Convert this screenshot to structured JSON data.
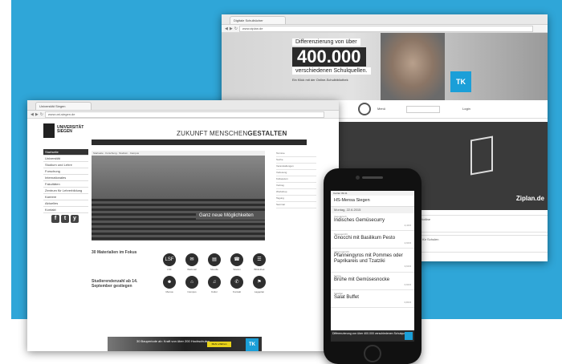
{
  "back_window": {
    "tab_title": "Digitale Schulbücher",
    "url": "www.ziplan.de",
    "banner_line1": "Differenzierung von über",
    "banner_number": "400.000",
    "banner_line3": "verschiedenen Schulquellen.",
    "banner_small": "Ein Klick mit der Online-Schulbibliothek",
    "tk_logo": "TK",
    "menu_label": "Menü",
    "login_label": "Login",
    "question_text": "n?",
    "brand": "Ziplan.de",
    "side_title": "Service-Hotline",
    "side_text": "Montag bis Freitag",
    "side_items": [
      "Service-Hotline",
      "Werbung für Schulen"
    ]
  },
  "front_window": {
    "tab_title": "Universität Siegen",
    "url": "www.uni-siegen.de",
    "logo_text": "UNIVERSITÄT SIEGEN",
    "slogan_light": "ZUKUNFT MENSCHEN",
    "slogan_bold": "GESTALTEN",
    "hero_tabs": "Startseite · Forschung · Studium · Campus",
    "hero_caption": "Ganz neue Möglichkeiten",
    "nav_items": [
      "Startseite",
      "Universität",
      "Studium und Lehre",
      "Forschung",
      "Internationales",
      "Fakultäten",
      "Zentrum für Lehrerbildung",
      "Karriere",
      "Aktuelles",
      "Kontakt"
    ],
    "social": [
      "f",
      "t",
      "y"
    ],
    "right_lines": [
      "Termine",
      "Suche",
      "Veranstaltungen",
      "Vorlesung",
      "Kolloquium",
      "Vortrag",
      "Workshop",
      "Tagung",
      "Seminar"
    ],
    "news_title": "30 Materialien im Fokus",
    "news_title2": "Studierendenzahl ab 14. September gestiegen",
    "icons": [
      {
        "glyph": "LSF",
        "label": "LSF"
      },
      {
        "glyph": "✉",
        "label": "Webmail"
      },
      {
        "glyph": "▤",
        "label": "Moodle"
      },
      {
        "glyph": "☎",
        "label": "Telefon"
      },
      {
        "glyph": "☰",
        "label": "Bibliothek"
      },
      {
        "glyph": "☻",
        "label": "Mensa"
      },
      {
        "glyph": "⌂",
        "label": "Campus"
      },
      {
        "glyph": "♫",
        "label": "Kultur"
      },
      {
        "glyph": "✆",
        "label": "Kontakt"
      },
      {
        "glyph": "⚑",
        "label": "Lageplan"
      }
    ],
    "banner_text": "30 Bauperiode ab: Kraft von über 200 Hochschulen",
    "banner_button": "Mehr erfahren",
    "banner_logo": "TK"
  },
  "phone": {
    "status": "Carrier  09:41",
    "header": "HS-Mensa Siegen",
    "date": "Montag, 22.6.2015",
    "meals": [
      {
        "kind": "Vegetarisch",
        "name": "Indisches Gemüsecurry",
        "price": "2,40 €"
      },
      {
        "kind": "Tagesgericht",
        "name": "Gnocchi mit Basilikum Pesto",
        "price": "2,90 €"
      },
      {
        "kind": "Aktionsgericht",
        "name": "Pfannengyros mit Pommes oder Paprikareis und Tzatziki",
        "price": "3,60 €"
      },
      {
        "kind": "Suppe",
        "name": "Brühe mit Gemüsesnocke",
        "price": "0,90 €"
      },
      {
        "kind": "Salatbar",
        "name": "Salat Buffet",
        "price": "0,80 €"
      }
    ],
    "ad_text": "Differenzierung von über 400.000 verschiedenen Schulquellen."
  }
}
